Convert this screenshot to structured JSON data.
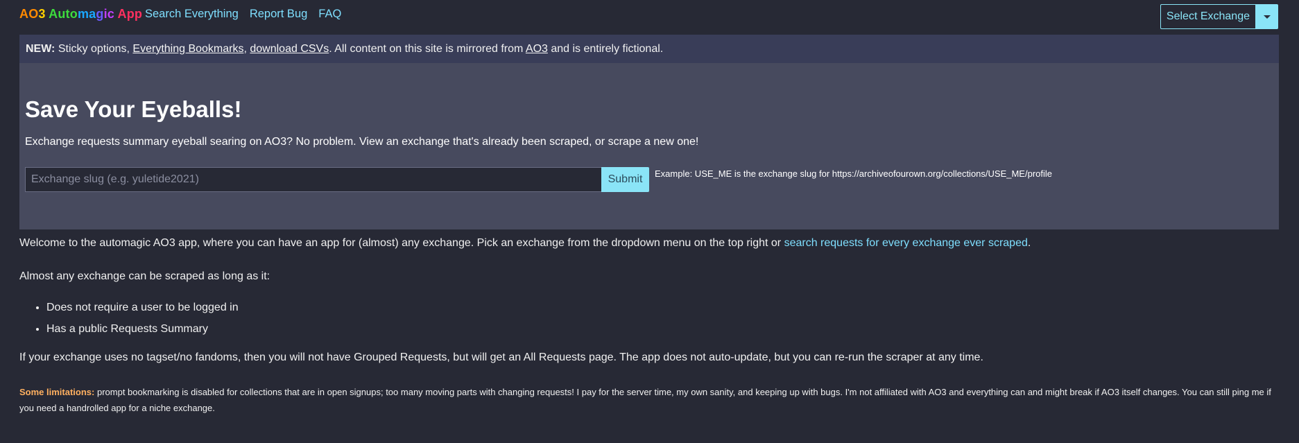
{
  "navbar": {
    "brand_parts": [
      "AO",
      "3 ",
      "Auto",
      "ma",
      "g",
      "ic ",
      "App"
    ],
    "links": [
      "Search Everything",
      "Report Bug",
      "FAQ"
    ],
    "select_label": "Select Exchange"
  },
  "notice": {
    "prefix": "NEW:",
    "text1": " Sticky options, ",
    "link1": "Everything Bookmarks",
    "text2": ", ",
    "link2": "download CSVs",
    "text3": ". All content on this site is mirrored from ",
    "link3": "AO3",
    "text4": " and is entirely fictional."
  },
  "hero": {
    "title": "Save Your Eyeballs!",
    "lead": "Exchange requests summary eyeball searing on AO3? No problem. View an exchange that's already been scraped, or scrape a new one!",
    "input_placeholder": "Exchange slug (e.g. yuletide2021)",
    "submit_label": "Submit",
    "example": "Example: USE_ME is the exchange slug for https://archiveofourown.org/collections/USE_ME/profile"
  },
  "content": {
    "welcome_text": "Welcome to the automagic AO3 app, where you can have an app for (almost) any exchange. Pick an exchange from the dropdown menu on the top right or ",
    "welcome_link": "search requests for every exchange ever scraped",
    "welcome_end": ".",
    "scrape_intro": "Almost any exchange can be scraped as long as it:",
    "requirements": [
      "Does not require a user to be logged in",
      "Has a public Requests Summary"
    ],
    "tagset_note": "If your exchange uses no tagset/no fandoms, then you will not have Grouped Requests, but will get an All Requests page. The app does not auto-update, but you can re-run the scraper at any time.",
    "limitations_label": "Some limitations:",
    "limitations_text": " prompt bookmarking is disabled for collections that are in open signups; too many moving parts with changing requests! I pay for the server time, my own sanity, and keeping up with bugs. I'm not affiliated with AO3 and everything can and might break if AO3 itself changes. You can still ping me if you need a handrolled app for a niche exchange."
  },
  "colors": {
    "background": "#272935",
    "accent": "#8ae4f7",
    "link": "#7fdfff",
    "hero_bg": "#474a5e",
    "notice_bg": "#393d58",
    "limitations_label": "#ffb060"
  }
}
